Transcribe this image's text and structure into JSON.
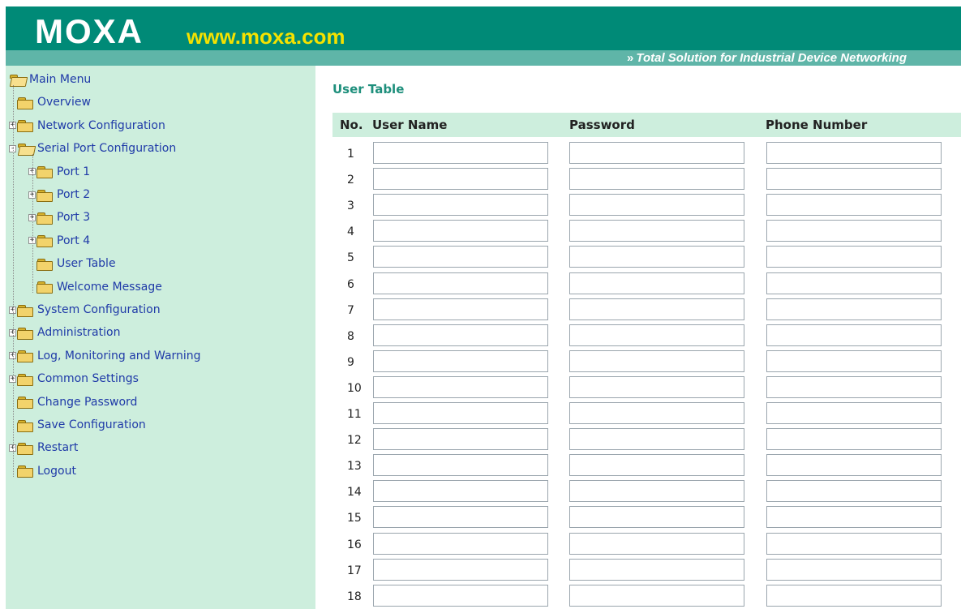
{
  "header": {
    "logo": "MOXA",
    "site": "www.moxa.com",
    "tagline": "Total Solution for Industrial Device Networking",
    "tagline_arrows": "»",
    "colors": {
      "band": "#008a77",
      "stripe": "#5fb5a8",
      "site": "#f5e200"
    }
  },
  "sidebar": {
    "items": [
      {
        "label": "Main Menu",
        "icon": "folder-open-icon",
        "toggle": ""
      },
      {
        "label": "Overview",
        "icon": "folder-icon",
        "toggle": ""
      },
      {
        "label": "Network Configuration",
        "icon": "folder-icon",
        "toggle": "+"
      },
      {
        "label": "Serial Port Configuration",
        "icon": "folder-open-icon",
        "toggle": "-"
      },
      {
        "label": "Port 1",
        "icon": "folder-icon",
        "toggle": "+"
      },
      {
        "label": "Port 2",
        "icon": "folder-icon",
        "toggle": "+"
      },
      {
        "label": "Port 3",
        "icon": "folder-icon",
        "toggle": "+"
      },
      {
        "label": "Port 4",
        "icon": "folder-icon",
        "toggle": "+"
      },
      {
        "label": "User Table",
        "icon": "folder-icon",
        "toggle": ""
      },
      {
        "label": "Welcome Message",
        "icon": "folder-icon",
        "toggle": ""
      },
      {
        "label": "System Configuration",
        "icon": "folder-icon",
        "toggle": "+"
      },
      {
        "label": "Administration",
        "icon": "folder-icon",
        "toggle": "+"
      },
      {
        "label": "Log, Monitoring and Warning",
        "icon": "folder-icon",
        "toggle": "+"
      },
      {
        "label": "Common Settings",
        "icon": "folder-icon",
        "toggle": "+"
      },
      {
        "label": "Change Password",
        "icon": "folder-icon",
        "toggle": ""
      },
      {
        "label": "Save Configuration",
        "icon": "folder-icon",
        "toggle": ""
      },
      {
        "label": "Restart",
        "icon": "folder-icon",
        "toggle": "+"
      },
      {
        "label": "Logout",
        "icon": "folder-icon",
        "toggle": ""
      }
    ]
  },
  "main": {
    "title": "User Table",
    "columns": [
      "No.",
      "User Name",
      "Password",
      "Phone Number"
    ],
    "rows": [
      {
        "no": "1",
        "user": "",
        "password": "",
        "phone": ""
      },
      {
        "no": "2",
        "user": "",
        "password": "",
        "phone": ""
      },
      {
        "no": "3",
        "user": "",
        "password": "",
        "phone": ""
      },
      {
        "no": "4",
        "user": "",
        "password": "",
        "phone": ""
      },
      {
        "no": "5",
        "user": "",
        "password": "",
        "phone": ""
      },
      {
        "no": "6",
        "user": "",
        "password": "",
        "phone": ""
      },
      {
        "no": "7",
        "user": "",
        "password": "",
        "phone": ""
      },
      {
        "no": "8",
        "user": "",
        "password": "",
        "phone": ""
      },
      {
        "no": "9",
        "user": "",
        "password": "",
        "phone": ""
      },
      {
        "no": "10",
        "user": "",
        "password": "",
        "phone": ""
      },
      {
        "no": "11",
        "user": "",
        "password": "",
        "phone": ""
      },
      {
        "no": "12",
        "user": "",
        "password": "",
        "phone": ""
      },
      {
        "no": "13",
        "user": "",
        "password": "",
        "phone": ""
      },
      {
        "no": "14",
        "user": "",
        "password": "",
        "phone": ""
      },
      {
        "no": "15",
        "user": "",
        "password": "",
        "phone": ""
      },
      {
        "no": "16",
        "user": "",
        "password": "",
        "phone": ""
      },
      {
        "no": "17",
        "user": "",
        "password": "",
        "phone": ""
      },
      {
        "no": "18",
        "user": "",
        "password": "",
        "phone": ""
      }
    ]
  }
}
